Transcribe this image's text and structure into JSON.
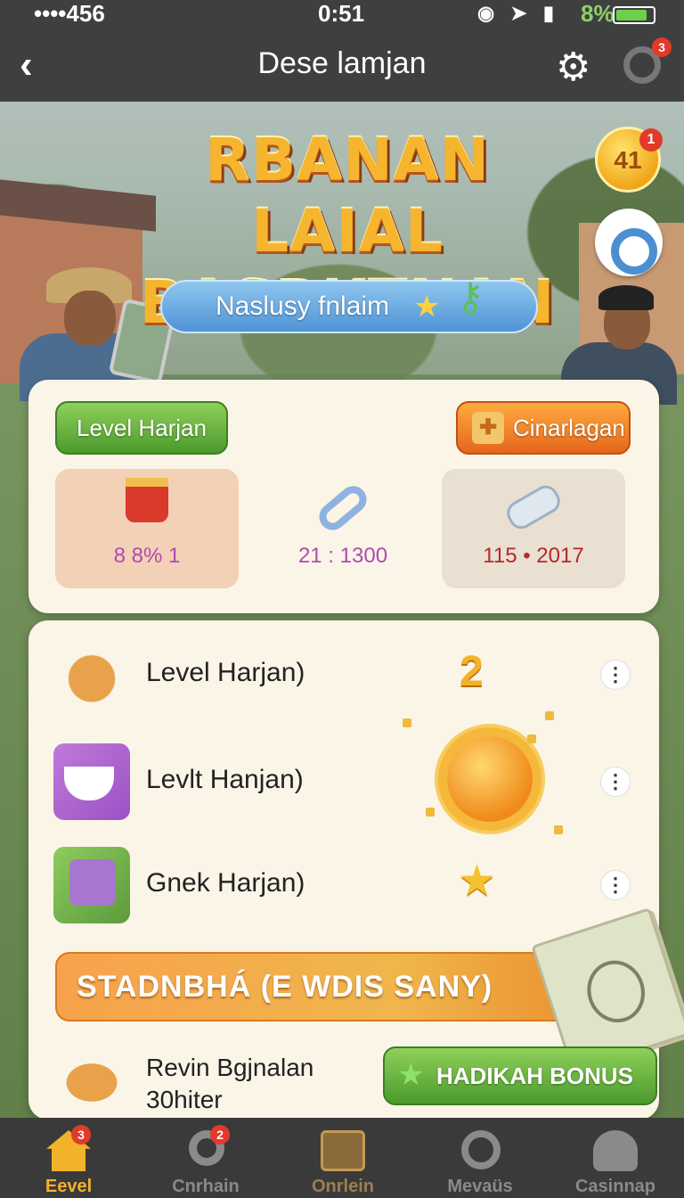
{
  "status_bar": {
    "signal": "••••456",
    "time": "0:51",
    "icons": [
      "alarm-icon",
      "location-icon",
      "nfc-icon"
    ],
    "battery_pct": "8%"
  },
  "nav": {
    "back_icon": "chevron-left-icon",
    "title": "Dese lamjan",
    "settings_icon": "gear-icon",
    "chat_badge": "3"
  },
  "hero": {
    "title_line1": "RBANAN LAIAL",
    "title_line2": "BASRKTNAN",
    "coin_value": "41",
    "coin_badge": "1",
    "pill_text": "Naslusy fnlaim"
  },
  "card1": {
    "left_button": "Level Harjan",
    "right_button": "Cinarlagan",
    "stats": [
      {
        "icon": "mug-icon",
        "value": "8 8% 1"
      },
      {
        "icon": "chain-link-icon",
        "value": "21 : 1300"
      },
      {
        "icon": "ticket-roll-icon",
        "value": "115 • 2017"
      }
    ]
  },
  "card2": {
    "rows": [
      {
        "icon": "cake-icon",
        "label": "Level Harjan)"
      },
      {
        "icon": "teacup-icon",
        "label": "Levlt Hanjan)"
      },
      {
        "icon": "gift-box-icon",
        "label": "Gnek Harjan)"
      }
    ],
    "floating_number": "2",
    "banner": "STADNBHÁ (E WDIS SANY)",
    "bottom_text_line1": "Revin Bgjnalan",
    "bottom_text_line2": "30hiter",
    "bonus_button": "HADIKAH BONUS"
  },
  "tabbar": {
    "tabs": [
      {
        "icon": "home-icon",
        "label": "Eevel",
        "badge": "3"
      },
      {
        "icon": "search-icon",
        "label": "Cnrhain",
        "badge": "2"
      },
      {
        "icon": "list-icon",
        "label": "Onrlein",
        "badge": ""
      },
      {
        "icon": "headset-icon",
        "label": "Mevaüs",
        "badge": ""
      },
      {
        "icon": "user-icon",
        "label": "Casinnap",
        "badge": ""
      }
    ],
    "active_index": 0
  },
  "colors": {
    "accent_gold": "#f2b22a",
    "green_button": "#4b9a2c",
    "orange_button": "#e5661b",
    "badge_red": "#e23a2a"
  }
}
